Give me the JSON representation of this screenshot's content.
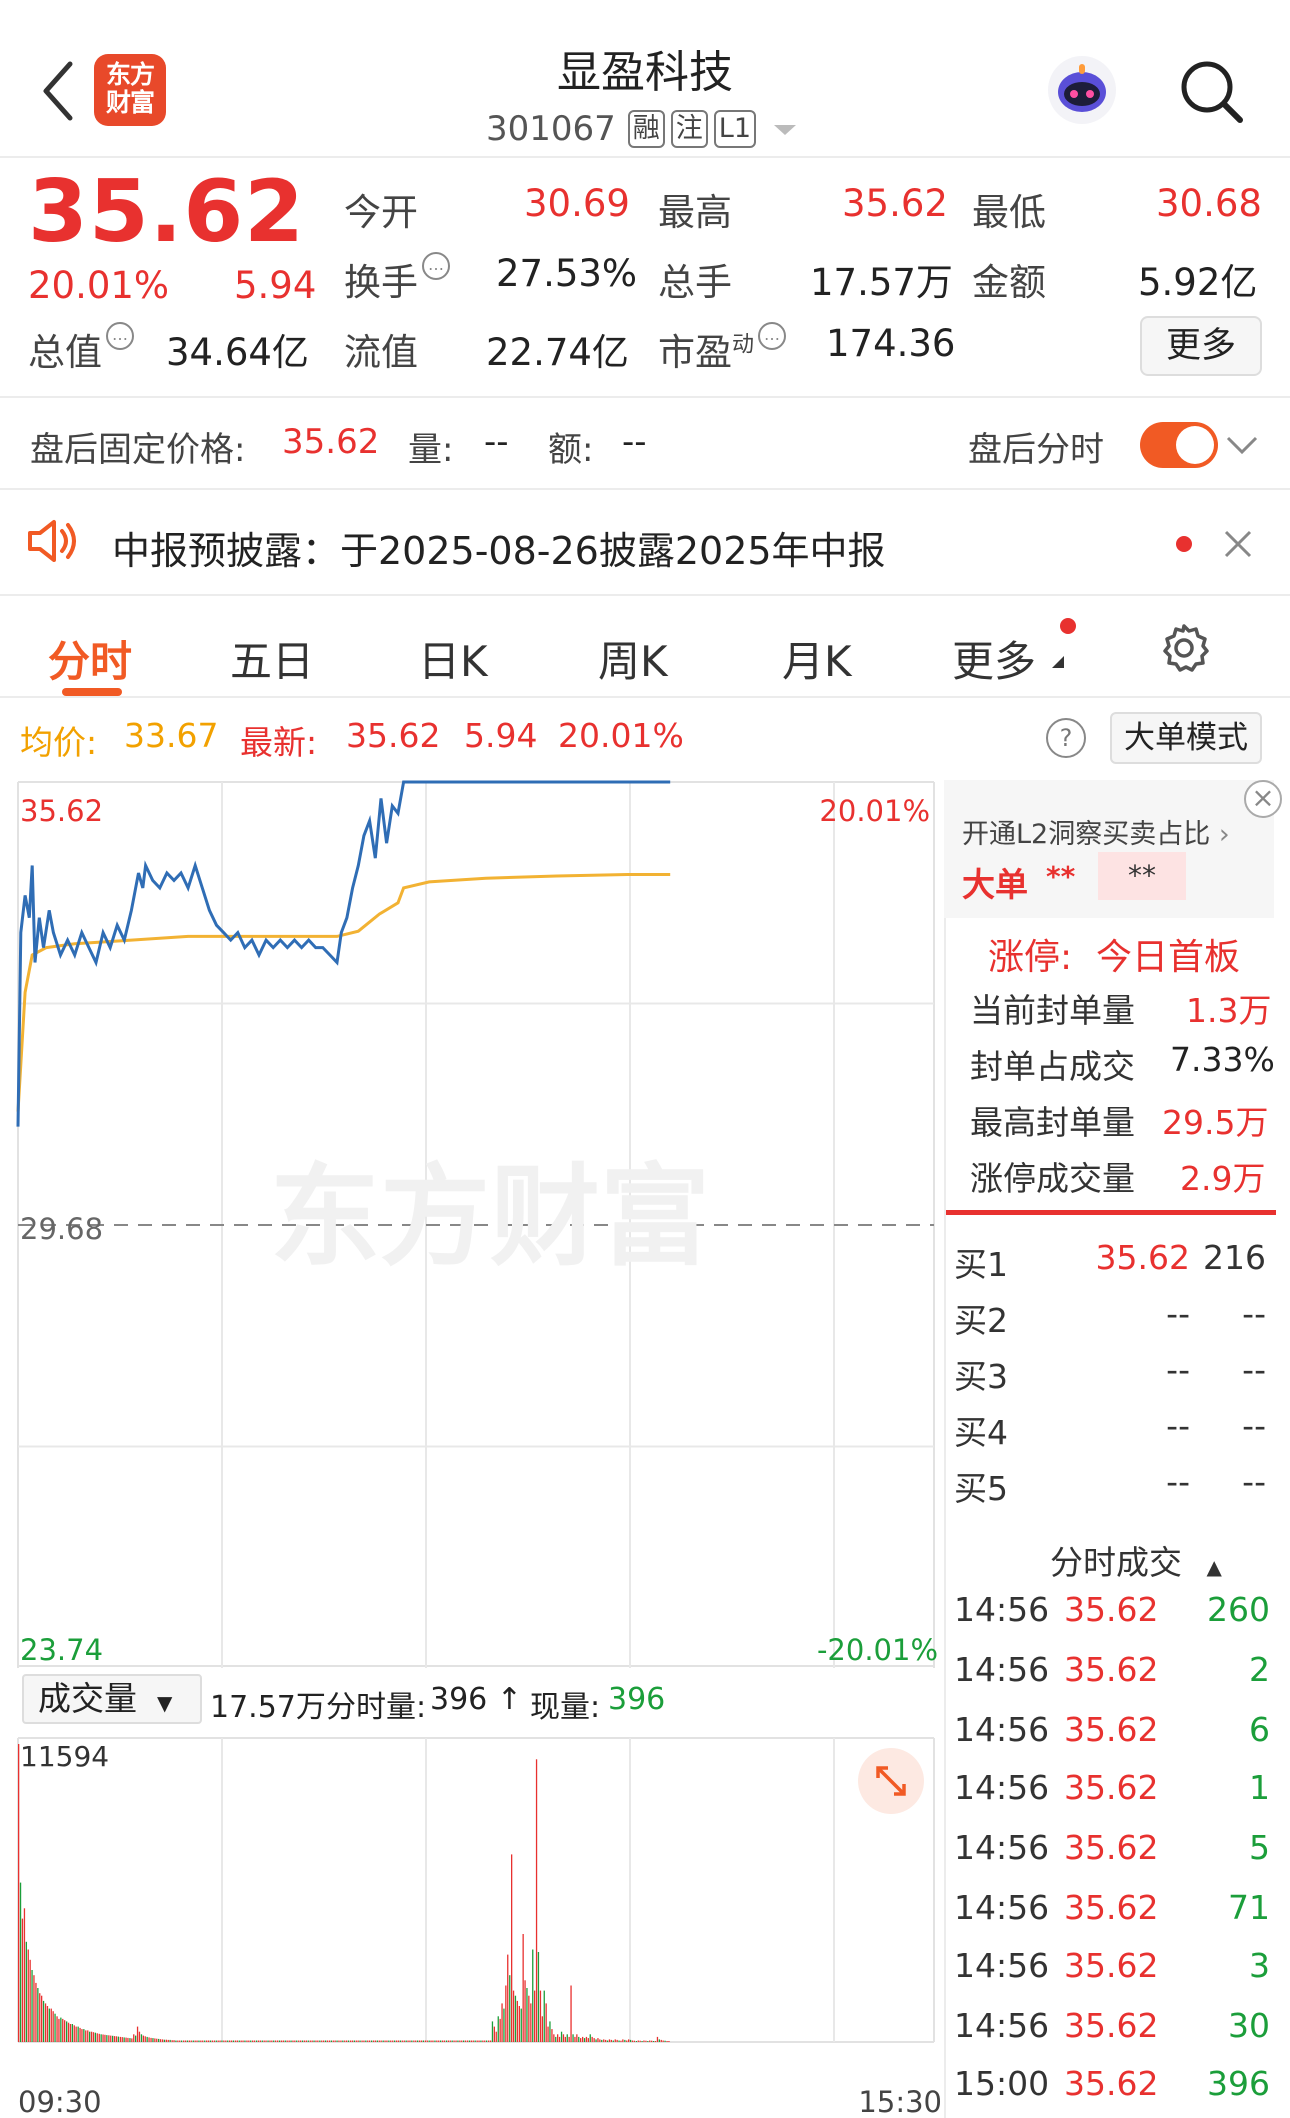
{
  "header": {
    "logo_line1": "东方",
    "logo_line2": "财富",
    "title": "显盈科技",
    "code": "301067",
    "tags": [
      "融",
      "注",
      "L1"
    ]
  },
  "quote": {
    "price": "35.62",
    "change_pct": "20.01%",
    "change": "5.94",
    "open_label": "今开",
    "open": "30.69",
    "high_label": "最高",
    "high": "35.62",
    "low_label": "最低",
    "low": "30.68",
    "turnover_label": "换手",
    "turnover": "27.53%",
    "volume_label": "总手",
    "volume": "17.57万",
    "amount_label": "金额",
    "amount": "5.92亿",
    "mktcap_label": "总值",
    "mktcap": "34.64亿",
    "float_label": "流值",
    "float": "22.74亿",
    "pe_label": "市盈",
    "pe_sup": "动",
    "pe": "174.36",
    "more_label": "更多"
  },
  "afterhours": {
    "fixed_label": "盘后固定价格:",
    "fixed_price": "35.62",
    "vol_label": "量:",
    "vol": "--",
    "amt_label": "额:",
    "amt": "--",
    "timeshare_label": "盘后分时"
  },
  "notice": {
    "text": "中报预披露：于2025-08-26披露2025年中报"
  },
  "tabs": [
    "分时",
    "五日",
    "日K",
    "周K",
    "月K",
    "更多"
  ],
  "legend": {
    "avg_label": "均价:",
    "avg": "33.67",
    "latest_label": "最新:",
    "latest": "35.62",
    "latest_change": "5.94",
    "latest_pct": "20.01%",
    "bigmode": "大单模式"
  },
  "chart_labels": {
    "top": "35.62",
    "top_pct": "20.01%",
    "mid": "29.68",
    "bottom": "23.74",
    "bottom_pct": "-20.01%",
    "watermark": "东方财富",
    "vol_max": "11594",
    "time_start": "09:30",
    "time_end": "15:30"
  },
  "volume_bar": {
    "select": "成交量",
    "total": "17.57万",
    "period_label": "分时量:",
    "period": "396 ↑",
    "now_label": "现量:",
    "now": "396"
  },
  "right": {
    "l2_text": "开通L2洞察买卖占比",
    "big_label": "大单",
    "big_v1": "**",
    "big_v2": "**",
    "limit_label": "涨停:",
    "limit_value": "今日首板",
    "seal_label": "当前封单量",
    "seal": "1.3万",
    "seal_ratio_label": "封单占成交",
    "seal_ratio": "7.33%",
    "max_seal_label": "最高封单量",
    "max_seal": "29.5万",
    "limit_vol_label": "涨停成交量",
    "limit_vol": "2.9万",
    "bids": [
      {
        "label": "买1",
        "price": "35.62",
        "qty": "216"
      },
      {
        "label": "买2",
        "price": "--",
        "qty": "--"
      },
      {
        "label": "买3",
        "price": "--",
        "qty": "--"
      },
      {
        "label": "买4",
        "price": "--",
        "qty": "--"
      },
      {
        "label": "买5",
        "price": "--",
        "qty": "--"
      }
    ],
    "ticks_title": "分时成交",
    "ticks": [
      {
        "t": "14:56",
        "p": "35.62",
        "v": "260"
      },
      {
        "t": "14:56",
        "p": "35.62",
        "v": "2"
      },
      {
        "t": "14:56",
        "p": "35.62",
        "v": "6"
      },
      {
        "t": "14:56",
        "p": "35.62",
        "v": "1"
      },
      {
        "t": "14:56",
        "p": "35.62",
        "v": "5"
      },
      {
        "t": "14:56",
        "p": "35.62",
        "v": "71"
      },
      {
        "t": "14:56",
        "p": "35.62",
        "v": "3"
      },
      {
        "t": "14:56",
        "p": "35.62",
        "v": "30"
      },
      {
        "t": "15:00",
        "p": "35.62",
        "v": "396"
      }
    ]
  },
  "colors": {
    "up": "#e8312f",
    "down": "#1b9e3a",
    "price_line": "#2f6db5",
    "avg_line": "#f2b233",
    "accent": "#f15a24"
  },
  "chart_data": {
    "type": "line",
    "ylim": [
      23.74,
      35.62
    ],
    "prev_close": 29.68,
    "price_points": [
      [
        0,
        31.0
      ],
      [
        2,
        33.6
      ],
      [
        5,
        34.1
      ],
      [
        8,
        33.8
      ],
      [
        10,
        34.5
      ],
      [
        12,
        33.2
      ],
      [
        15,
        33.8
      ],
      [
        18,
        33.4
      ],
      [
        22,
        33.9
      ],
      [
        25,
        33.6
      ],
      [
        30,
        33.3
      ],
      [
        35,
        33.5
      ],
      [
        40,
        33.3
      ],
      [
        45,
        33.6
      ],
      [
        50,
        33.4
      ],
      [
        55,
        33.2
      ],
      [
        60,
        33.6
      ],
      [
        65,
        33.4
      ],
      [
        70,
        33.7
      ],
      [
        75,
        33.5
      ],
      [
        80,
        33.9
      ],
      [
        85,
        34.4
      ],
      [
        88,
        34.2
      ],
      [
        90,
        34.5
      ],
      [
        95,
        34.3
      ],
      [
        100,
        34.2
      ],
      [
        105,
        34.4
      ],
      [
        110,
        34.3
      ],
      [
        115,
        34.4
      ],
      [
        120,
        34.2
      ],
      [
        125,
        34.5
      ],
      [
        130,
        34.2
      ],
      [
        135,
        33.9
      ],
      [
        140,
        33.7
      ],
      [
        145,
        33.6
      ],
      [
        150,
        33.5
      ],
      [
        155,
        33.6
      ],
      [
        160,
        33.4
      ],
      [
        165,
        33.5
      ],
      [
        170,
        33.3
      ],
      [
        175,
        33.5
      ],
      [
        180,
        33.4
      ],
      [
        185,
        33.5
      ],
      [
        190,
        33.4
      ],
      [
        195,
        33.5
      ],
      [
        200,
        33.4
      ],
      [
        205,
        33.5
      ],
      [
        210,
        33.4
      ],
      [
        215,
        33.4
      ],
      [
        220,
        33.3
      ],
      [
        225,
        33.2
      ],
      [
        228,
        33.6
      ],
      [
        232,
        33.8
      ],
      [
        236,
        34.2
      ],
      [
        240,
        34.5
      ],
      [
        244,
        34.9
      ],
      [
        248,
        35.1
      ],
      [
        252,
        34.6
      ],
      [
        256,
        35.4
      ],
      [
        260,
        34.8
      ],
      [
        264,
        35.3
      ],
      [
        268,
        35.2
      ],
      [
        272,
        35.62
      ],
      [
        290,
        35.62
      ],
      [
        330,
        35.62
      ],
      [
        380,
        35.62
      ],
      [
        430,
        35.62
      ],
      [
        460,
        35.62
      ]
    ],
    "avg_points": [
      [
        0,
        31.2
      ],
      [
        5,
        32.8
      ],
      [
        10,
        33.3
      ],
      [
        20,
        33.4
      ],
      [
        40,
        33.45
      ],
      [
        80,
        33.5
      ],
      [
        120,
        33.55
      ],
      [
        160,
        33.55
      ],
      [
        200,
        33.55
      ],
      [
        225,
        33.55
      ],
      [
        240,
        33.62
      ],
      [
        255,
        33.85
      ],
      [
        268,
        34.0
      ],
      [
        272,
        34.2
      ],
      [
        290,
        34.28
      ],
      [
        330,
        34.33
      ],
      [
        380,
        34.36
      ],
      [
        430,
        34.38
      ],
      [
        460,
        34.38
      ]
    ],
    "volume": [
      11594,
      6200,
      4800,
      5200,
      3900,
      3600,
      3200,
      2800,
      2600,
      2300,
      2100,
      1900,
      1800,
      1600,
      1500,
      1400,
      1300,
      1300,
      1200,
      1100,
      1000,
      900,
      950,
      900,
      850,
      800,
      750,
      700,
      700,
      650,
      600,
      600,
      550,
      500,
      500,
      450,
      450,
      400,
      400,
      380,
      360,
      340,
      320,
      300,
      290,
      280,
      270,
      260,
      250,
      240,
      230,
      220,
      210,
      200,
      190,
      180,
      170,
      160,
      150,
      140,
      300,
      250,
      600,
      400,
      300,
      250,
      220,
      200,
      180,
      160,
      150,
      140,
      130,
      120,
      110,
      100,
      90,
      90,
      80,
      80,
      70,
      70,
      60,
      60,
      60,
      60,
      60,
      60,
      60,
      60,
      60,
      60,
      60,
      60,
      60,
      60,
      60,
      60,
      60,
      60,
      60,
      60,
      60,
      60,
      60,
      60,
      60,
      60,
      60,
      60,
      60,
      60,
      60,
      60,
      60,
      60,
      60,
      60,
      60,
      60,
      60,
      60,
      60,
      60,
      60,
      60,
      60,
      60,
      60,
      60,
      60,
      60,
      60,
      60,
      60,
      60,
      60,
      60,
      60,
      60,
      60,
      60,
      60,
      60,
      60,
      60,
      60,
      60,
      60,
      60,
      60,
      60,
      60,
      60,
      60,
      60,
      60,
      60,
      60,
      60,
      60,
      60,
      60,
      60,
      60,
      60,
      60,
      60,
      60,
      60,
      60,
      60,
      60,
      60,
      60,
      60,
      60,
      60,
      60,
      60,
      60,
      60,
      60,
      60,
      60,
      60,
      60,
      60,
      60,
      60,
      60,
      60,
      60,
      60,
      60,
      60,
      60,
      60,
      60,
      60,
      60,
      60,
      60,
      60,
      60,
      60,
      60,
      60,
      60,
      60,
      60,
      60,
      60,
      60,
      60,
      60,
      60,
      60,
      60,
      60,
      60,
      60,
      60,
      60,
      60,
      60,
      60,
      60,
      60,
      60,
      60,
      60,
      60,
      60,
      60,
      60,
      60,
      60,
      60,
      60,
      60,
      60,
      60,
      60,
      60,
      60,
      60,
      800,
      600,
      400,
      1000,
      900,
      1500,
      1300,
      2200,
      3400,
      2600,
      7300,
      2000,
      1800,
      1600,
      1400,
      1300,
      4200,
      2400,
      2100,
      1800,
      1500,
      3600,
      2000,
      11000,
      3500,
      2000,
      1000,
      2000,
      1500,
      600,
      800,
      500,
      300,
      200,
      300,
      200,
      400,
      300,
      200,
      300,
      200,
      2200,
      300,
      200,
      300,
      200,
      150,
      200,
      150,
      200,
      150,
      300,
      200,
      150,
      100,
      150,
      100,
      80,
      100,
      80,
      60,
      100,
      80,
      60,
      100,
      80,
      60,
      50,
      100,
      80,
      60,
      100,
      80,
      60,
      50,
      40,
      60,
      50,
      40,
      60,
      50,
      40,
      60,
      50,
      40,
      30,
      200,
      100,
      80,
      60,
      50,
      40,
      30
    ]
  }
}
